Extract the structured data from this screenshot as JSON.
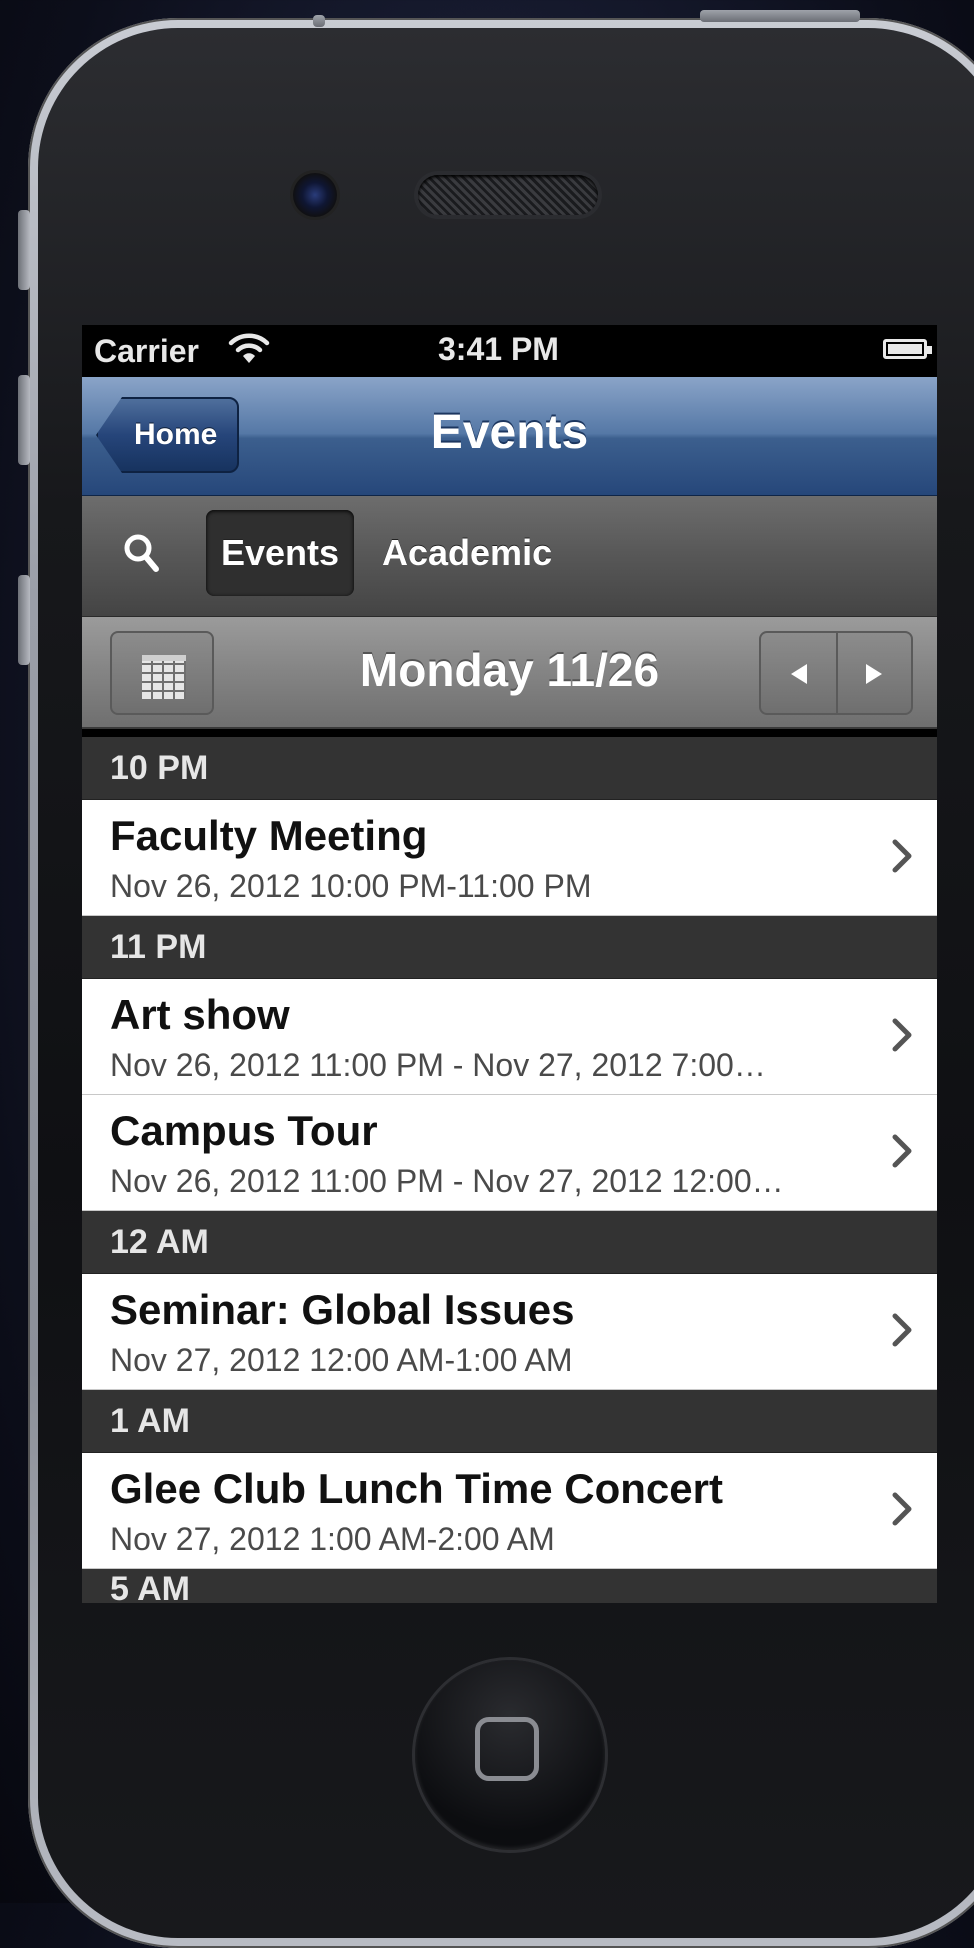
{
  "status_bar": {
    "carrier": "Carrier",
    "time": "3:41 PM"
  },
  "nav": {
    "back_label": "Home",
    "title": "Events"
  },
  "tabs": [
    {
      "label": "Events",
      "selected": true
    },
    {
      "label": "Academic",
      "selected": false
    }
  ],
  "date_bar": {
    "label": "Monday 11/26",
    "prev_icon": "triangle-left",
    "next_icon": "triangle-right"
  },
  "sections": [
    {
      "header": "10 PM",
      "events": [
        {
          "title": "Faculty Meeting",
          "subtitle": "Nov 26, 2012 10:00 PM-11:00 PM"
        }
      ]
    },
    {
      "header": "11 PM",
      "events": [
        {
          "title": "Art show",
          "subtitle": "Nov 26, 2012 11:00 PM - Nov 27, 2012 7:00…"
        },
        {
          "title": "Campus Tour",
          "subtitle": "Nov 26, 2012 11:00 PM - Nov 27, 2012 12:00…"
        }
      ]
    },
    {
      "header": "12 AM",
      "events": [
        {
          "title": "Seminar: Global Issues",
          "subtitle": "Nov 27, 2012 12:00 AM-1:00 AM"
        }
      ]
    },
    {
      "header": "1 AM",
      "events": [
        {
          "title": "Glee Club Lunch Time Concert",
          "subtitle": "Nov 27, 2012 1:00 AM-2:00 AM"
        }
      ]
    }
  ],
  "partial_header": "5 AM",
  "colors": {
    "nav_blue": "#3c5f8e",
    "section_header": "#333333",
    "row_bg": "#ffffff"
  }
}
